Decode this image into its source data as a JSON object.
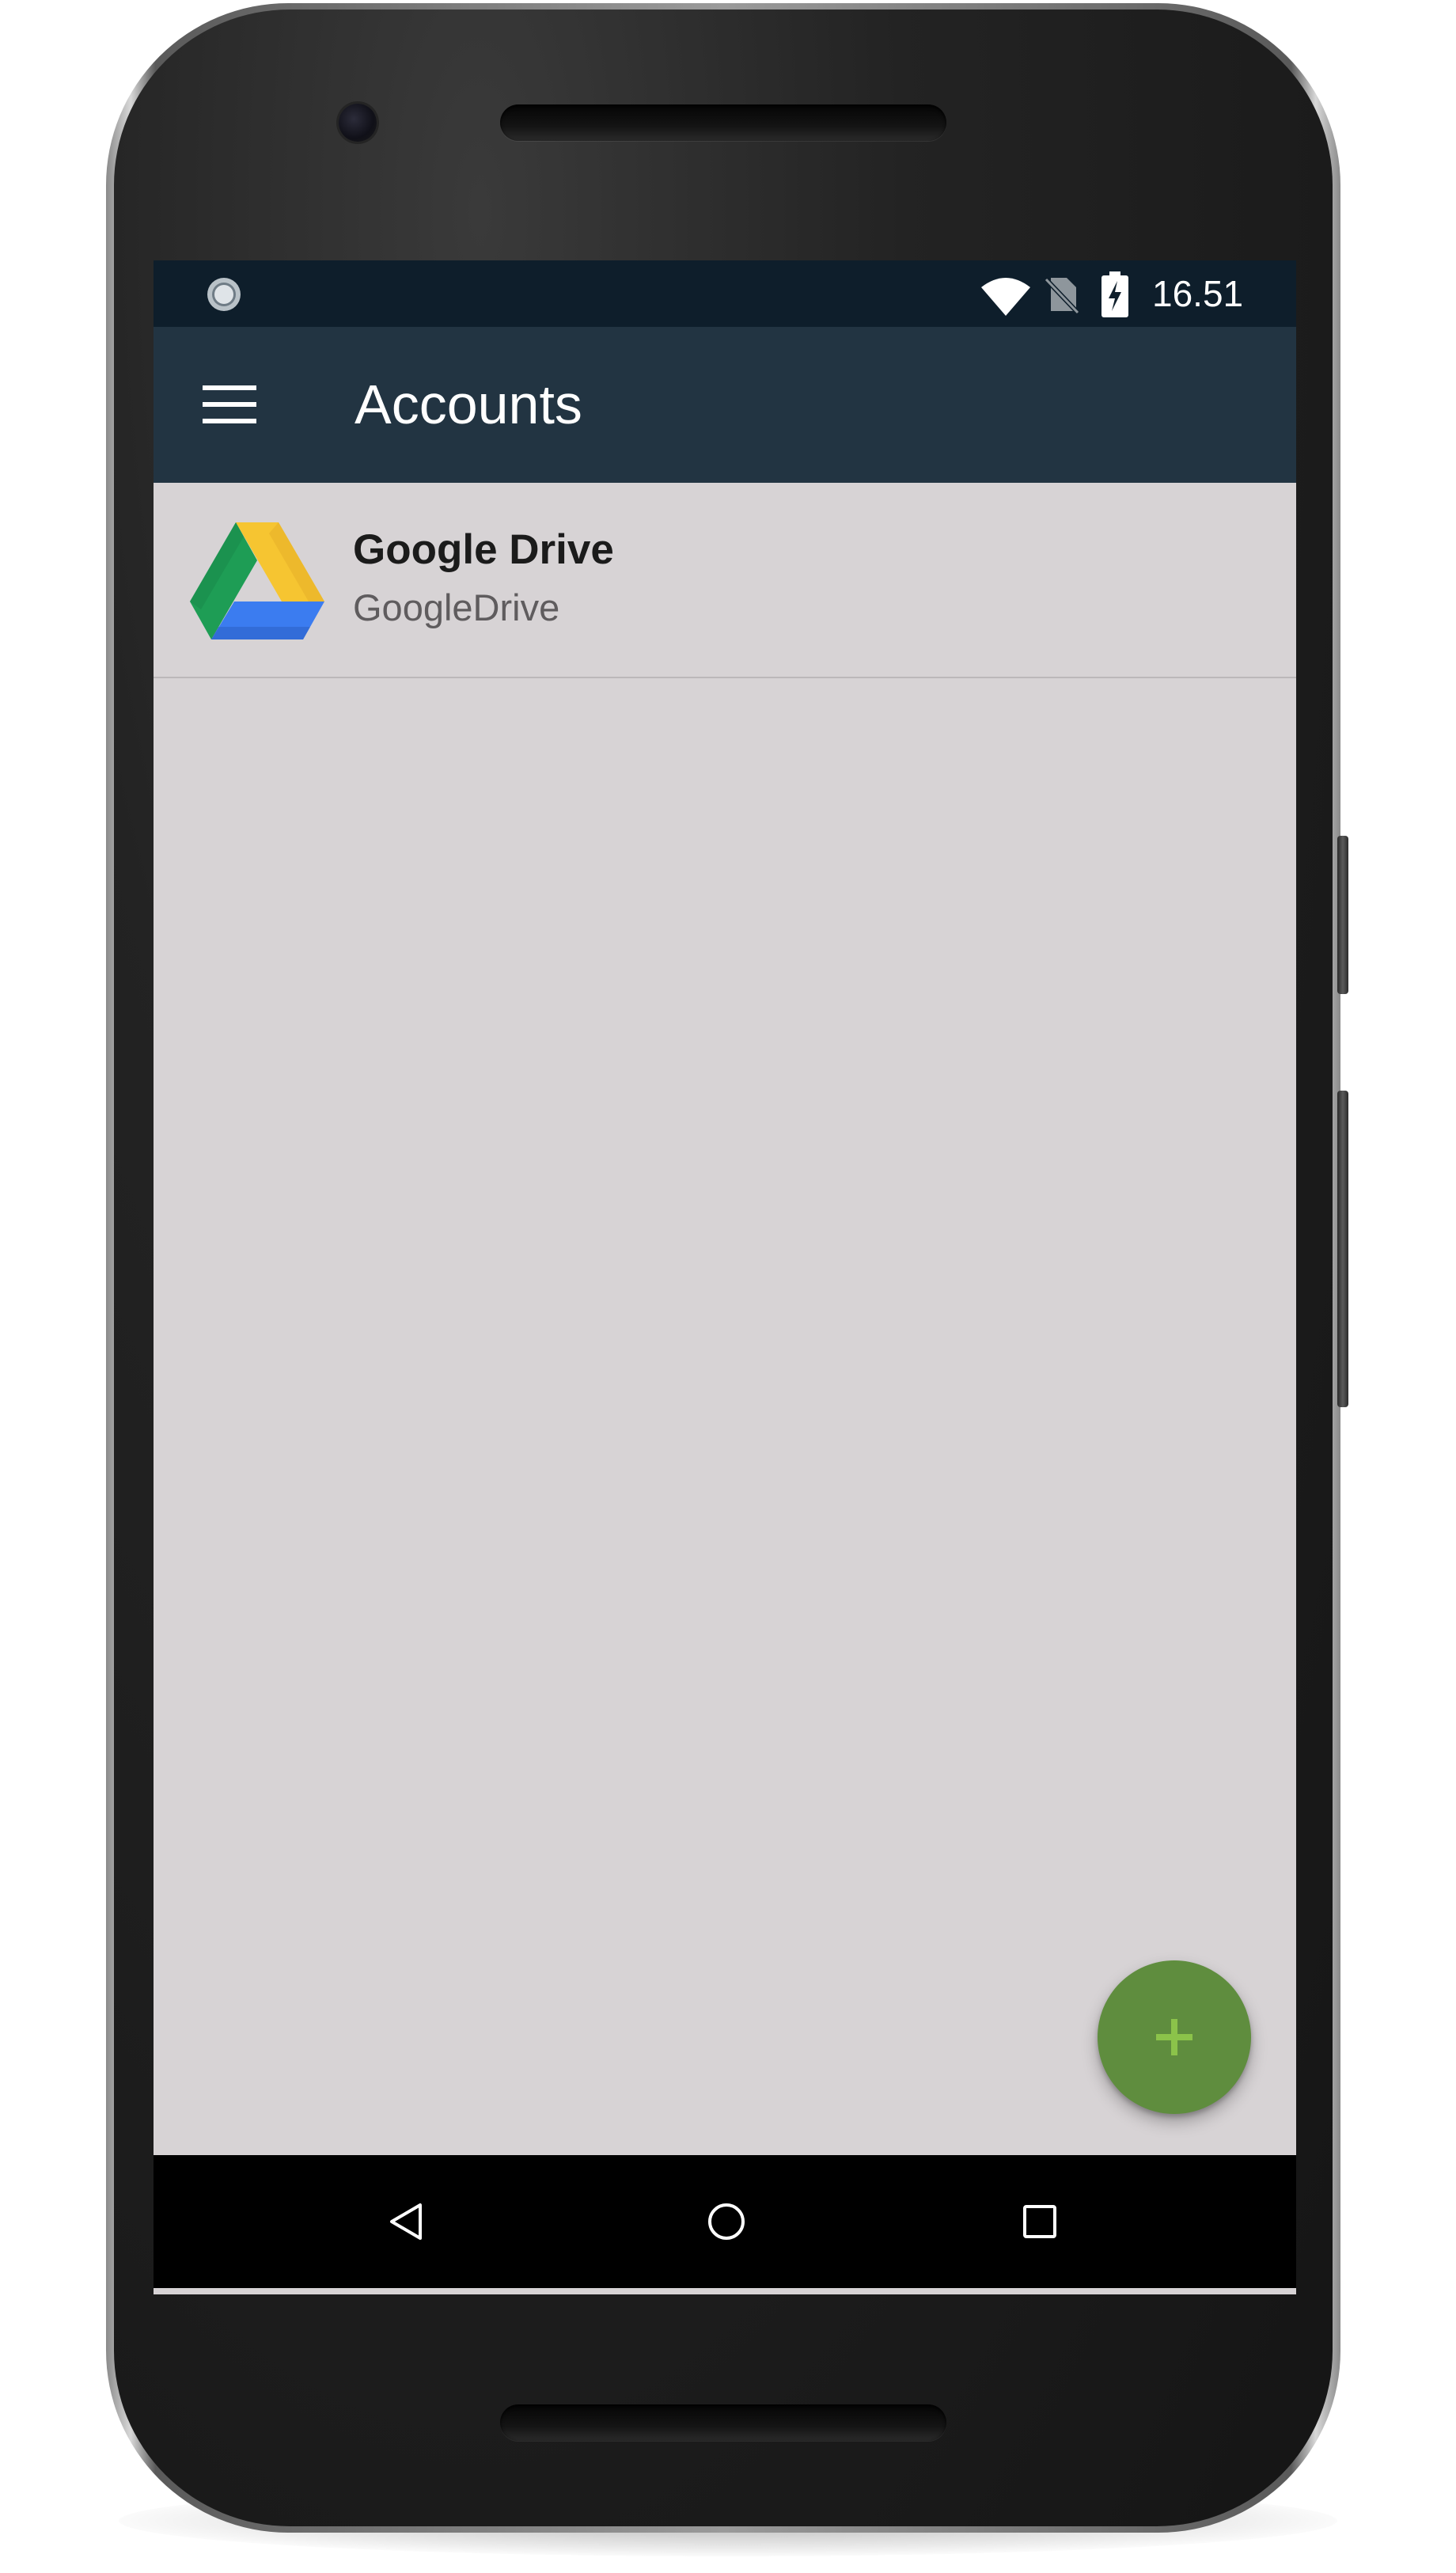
{
  "status_bar": {
    "time": "16.51",
    "icons": [
      "sync-icon",
      "wifi-icon",
      "no-sim-icon",
      "battery-charging-icon"
    ]
  },
  "app_bar": {
    "title": "Accounts",
    "menu_icon": "hamburger-menu-icon",
    "color": "#223442"
  },
  "accounts": [
    {
      "name": "Google Drive",
      "type": "GoogleDrive",
      "icon": "google-drive-icon"
    }
  ],
  "fab": {
    "icon": "plus-icon",
    "color": "#5f8d3e",
    "icon_color": "#8bc34a"
  },
  "navigation_bar": {
    "buttons": [
      "back-icon",
      "home-icon",
      "recents-icon"
    ]
  },
  "colors": {
    "status_bar": "#0e1e2b",
    "screen_background": "#d7d3d5"
  }
}
